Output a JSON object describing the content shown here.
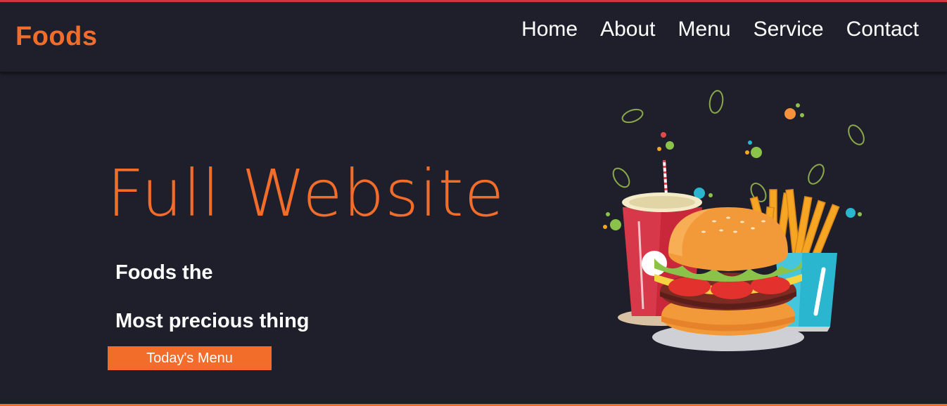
{
  "header": {
    "logo": "Foods",
    "nav": [
      "Home",
      "About",
      "Menu",
      "Service",
      "Contact"
    ]
  },
  "hero": {
    "title": "Full Website",
    "line1": "Foods the",
    "line2": "Most precious thing",
    "button": "Today's Menu",
    "image": "burger-fries-drink-illustration"
  },
  "colors": {
    "background": "#1f1f2c",
    "accent": "#f26c2a",
    "top_border": "#d9363e",
    "text": "#ffffff"
  }
}
